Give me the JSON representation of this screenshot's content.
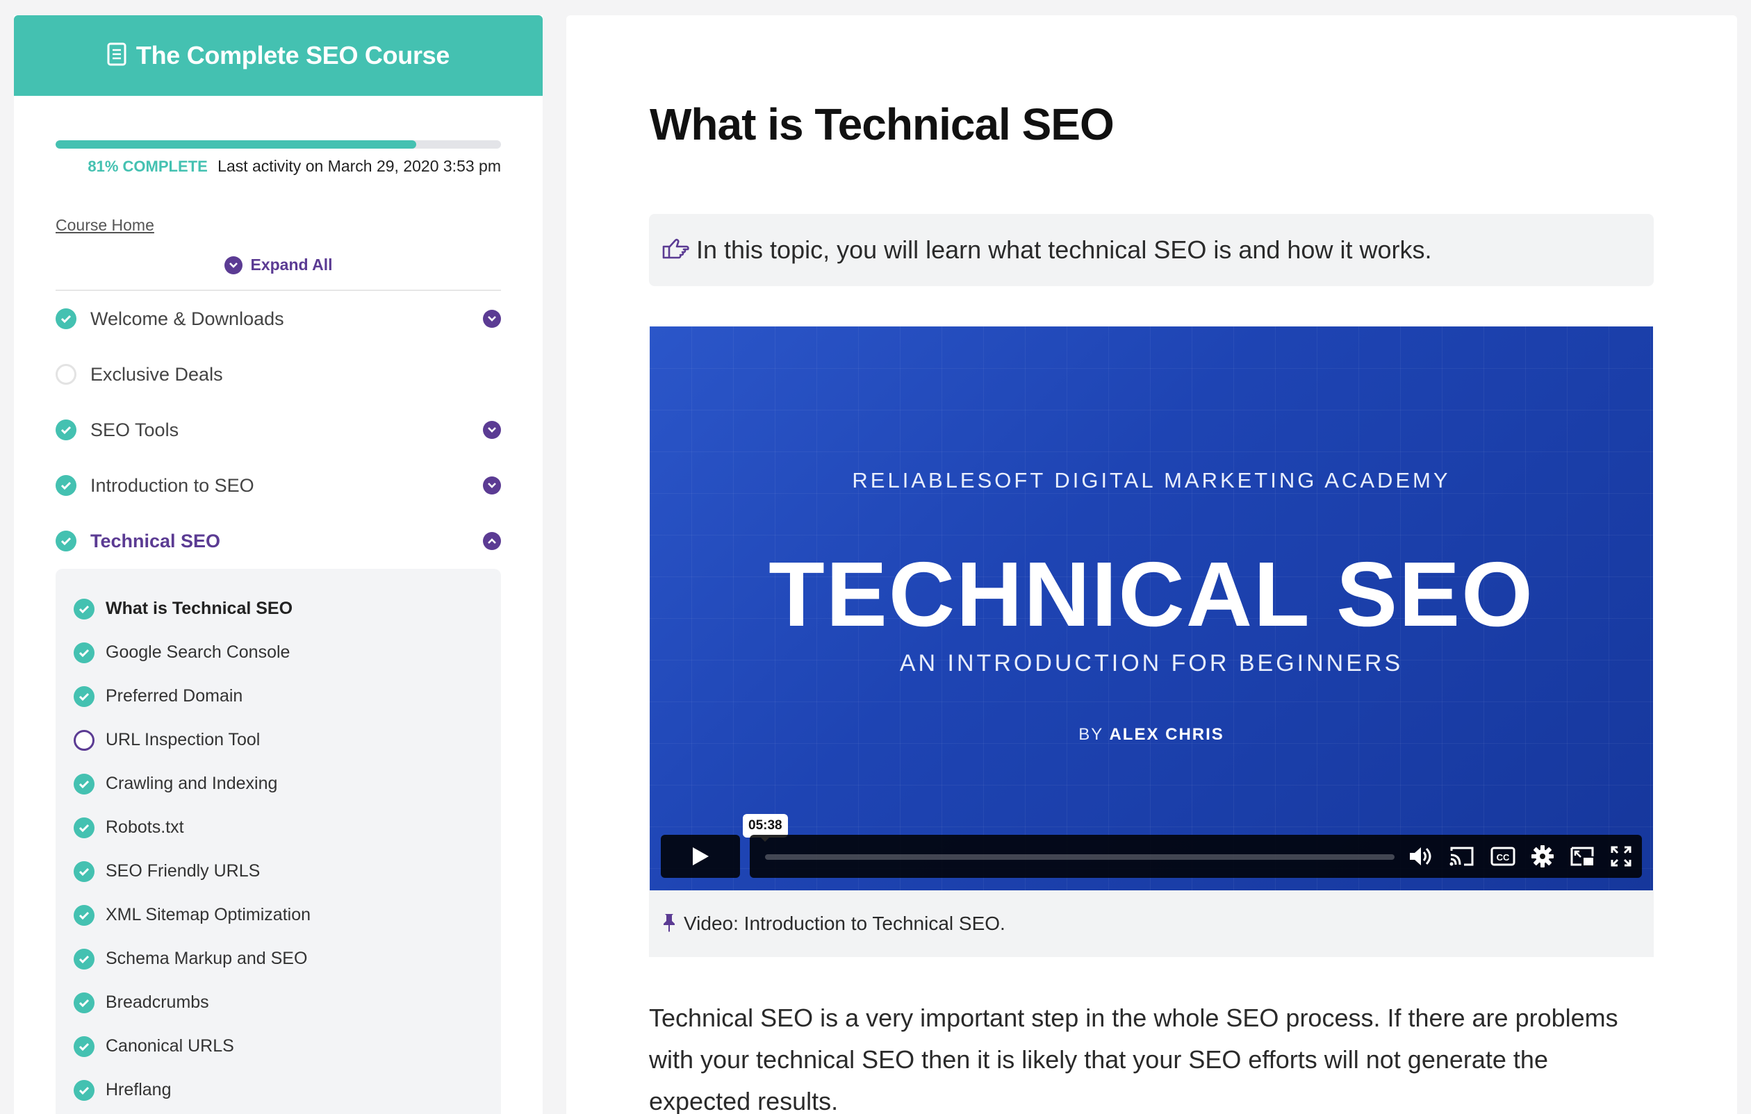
{
  "sidebar": {
    "course_title": "The Complete SEO Course",
    "progress": {
      "percent": 81,
      "label": "81% COMPLETE",
      "last_activity": "Last activity on March 29, 2020 3:53 pm"
    },
    "course_home": "Course Home",
    "expand_all": "Expand All",
    "lessons": [
      {
        "label": "Welcome & Downloads",
        "status": "complete",
        "expandable": true
      },
      {
        "label": "Exclusive Deals",
        "status": "incomplete",
        "expandable": false
      },
      {
        "label": "SEO Tools",
        "status": "complete",
        "expandable": true
      },
      {
        "label": "Introduction to SEO",
        "status": "complete",
        "expandable": true
      },
      {
        "label": "Technical SEO",
        "status": "complete",
        "expandable": true,
        "expanded": true
      }
    ],
    "topics": [
      {
        "label": "What is Technical SEO",
        "status": "complete",
        "current": true
      },
      {
        "label": "Google Search Console",
        "status": "complete"
      },
      {
        "label": "Preferred Domain",
        "status": "complete"
      },
      {
        "label": "URL Inspection Tool",
        "status": "in-progress"
      },
      {
        "label": "Crawling and Indexing",
        "status": "complete"
      },
      {
        "label": "Robots.txt",
        "status": "complete"
      },
      {
        "label": "SEO Friendly URLS",
        "status": "complete"
      },
      {
        "label": "XML Sitemap Optimization",
        "status": "complete"
      },
      {
        "label": "Schema Markup and SEO",
        "status": "complete"
      },
      {
        "label": "Breadcrumbs",
        "status": "complete"
      },
      {
        "label": "Canonical URLS",
        "status": "complete"
      },
      {
        "label": "Hreflang",
        "status": "complete"
      }
    ]
  },
  "main": {
    "title": "What is Technical SEO",
    "note": "In this topic, you will learn what technical SEO is and how it works.",
    "video": {
      "academy": "RELIABLESOFT DIGITAL MARKETING ACADEMY",
      "title": "TECHNICAL SEO",
      "subtitle": "AN INTRODUCTION FOR BEGINNERS",
      "by_prefix": "BY",
      "author": "ALEX CHRIS",
      "duration": "05:38"
    },
    "caption": "Video: Introduction to Technical SEO.",
    "body": "Technical SEO is a very important step in the whole SEO process. If there are problems with your technical SEO then it is likely that your SEO efforts will not generate the expected results."
  },
  "colors": {
    "accent": "#44c1b1",
    "purple": "#5b3b93",
    "video_blue": "#1e44b3"
  }
}
